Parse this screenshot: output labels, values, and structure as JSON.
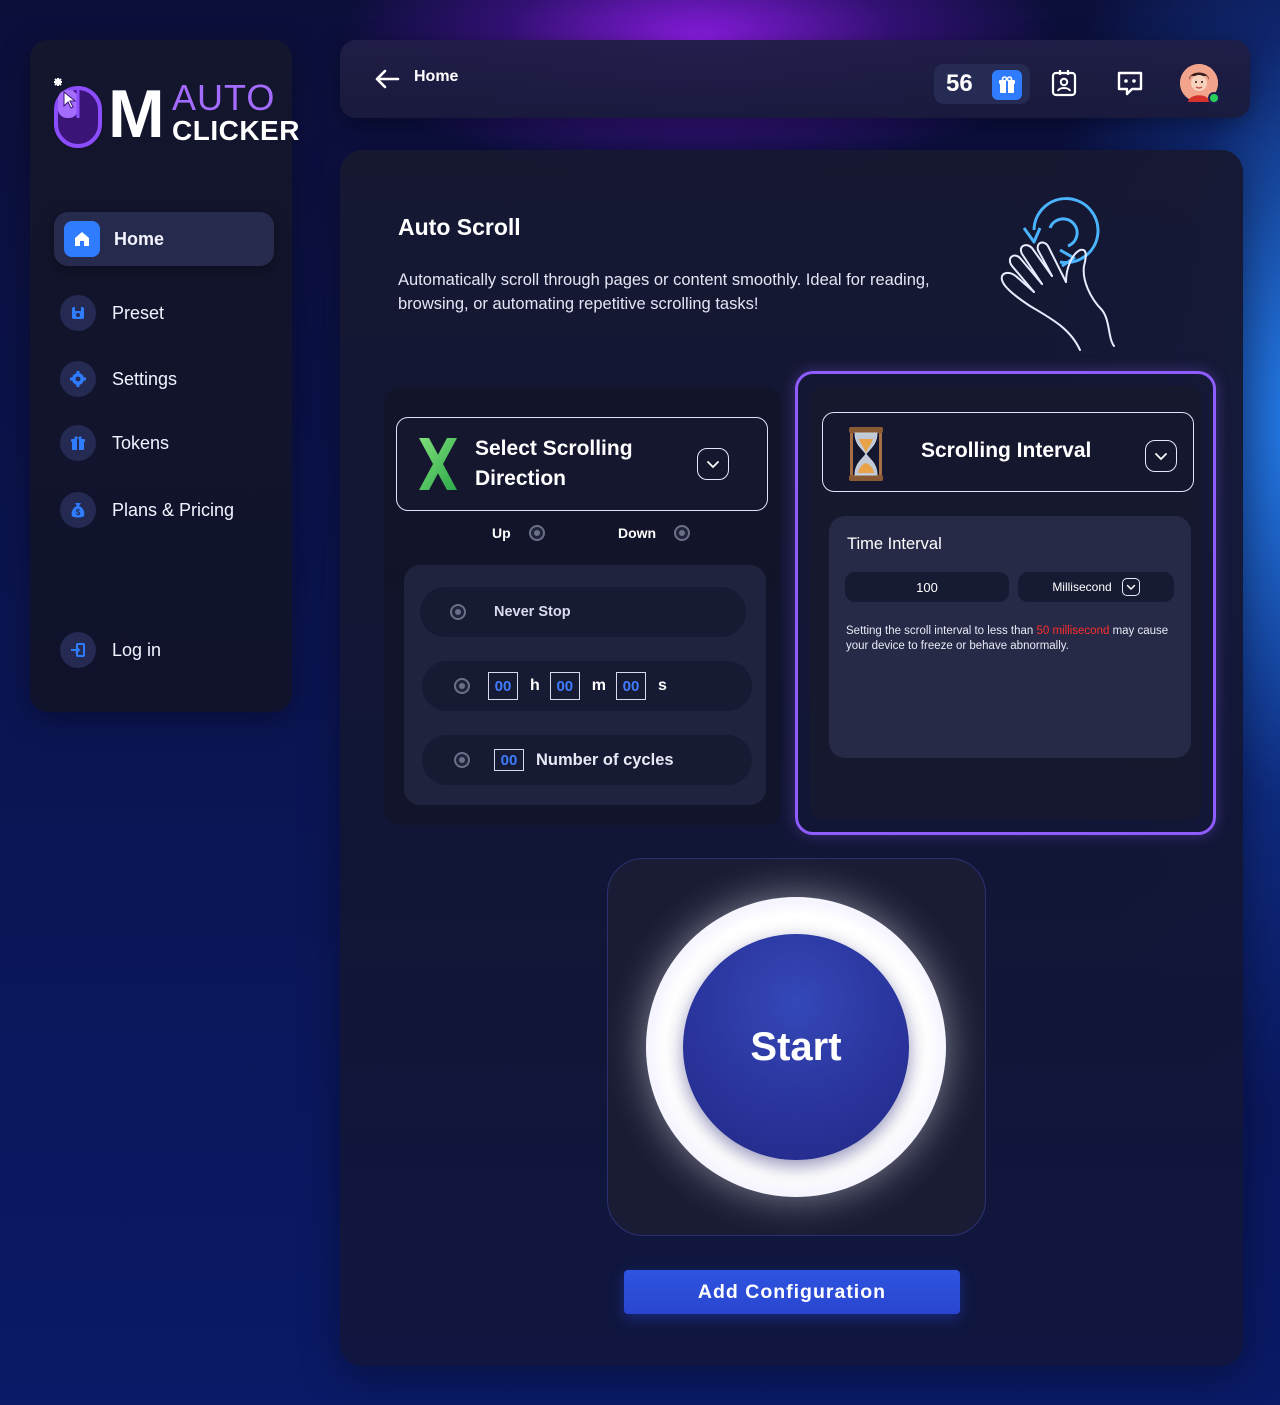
{
  "app": {
    "logo_auto": "AUTO",
    "logo_clicker": "CLICKER",
    "logo_m": "M"
  },
  "sidebar": {
    "items": [
      {
        "label": "Home",
        "icon": "home-icon",
        "active": true
      },
      {
        "label": "Preset",
        "icon": "preset-icon",
        "active": false
      },
      {
        "label": "Settings",
        "icon": "gear-icon",
        "active": false
      },
      {
        "label": "Tokens",
        "icon": "gift-icon",
        "active": false
      },
      {
        "label": "Plans & Pricing",
        "icon": "money-bag-icon",
        "active": false
      }
    ],
    "login_label": "Log in"
  },
  "topbar": {
    "breadcrumb": "Home",
    "token_count": "56",
    "icons": [
      "gift-icon",
      "contact-card-icon",
      "chat-icon",
      "avatar"
    ]
  },
  "main": {
    "title": "Auto Scroll",
    "description": "Automatically scroll through pages or content smoothly. Ideal for reading, browsing, or automating repetitive scrolling tasks!"
  },
  "direction": {
    "title": "Select Scrolling Direction",
    "options": [
      "Up",
      "Down"
    ],
    "stop_options": {
      "never_stop": "Never Stop",
      "time": {
        "hours": "00",
        "h": "h",
        "minutes": "00",
        "m": "m",
        "seconds": "00",
        "s": "s"
      },
      "cycles": {
        "value": "00",
        "label": "Number of cycles"
      }
    }
  },
  "interval": {
    "title": "Scrolling Interval",
    "time_label": "Time Interval",
    "value": "100",
    "unit": "Millisecond",
    "warning_pre": "Setting the scroll interval to less than ",
    "warning_red": "50 millisecond",
    "warning_post": " may cause your device to freeze or behave abnormally."
  },
  "actions": {
    "start": "Start",
    "add_config": "Add Configuration"
  },
  "colors": {
    "accent_blue": "#2f7cff",
    "accent_purple": "#8f5cff",
    "warning_red": "#ff2d2d",
    "start_blue": "#2a349c"
  }
}
